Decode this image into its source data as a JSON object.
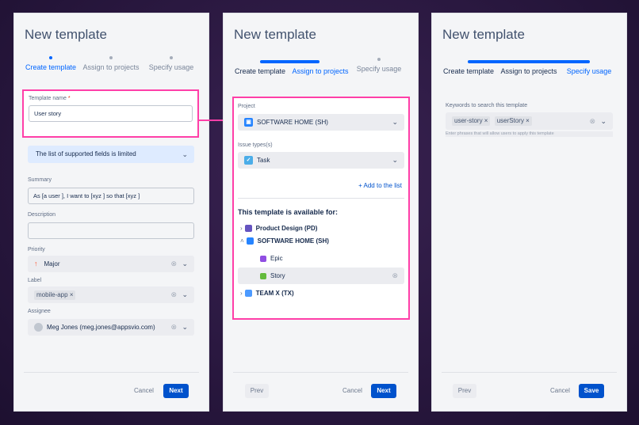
{
  "panels": [
    {
      "title": "New template",
      "steps": [
        "Create template",
        "Assign to projects",
        "Specify usage"
      ],
      "template_name_label": "Template name",
      "required_mark": "*",
      "template_name_value": "User story",
      "info_banner": "The list of supported fields is limited",
      "summary_label": "Summary",
      "summary_value": "As [a user ], I want to [xyz ] so that [xyz ]",
      "description_label": "Description",
      "priority_label": "Priority",
      "priority_value": "Major",
      "label_label": "Label",
      "label_tag": "mobile-app",
      "assignee_label": "Assignee",
      "assignee_value": "Meg Jones (meg.jones@appsvio.com)",
      "cancel": "Cancel",
      "next": "Next"
    },
    {
      "title": "New template",
      "steps": [
        "Create template",
        "Assign to projects",
        "Specify usage"
      ],
      "project_label": "Project",
      "project_value": "SOFTWARE HOME (SH)",
      "issue_types_label": "Issue types(s)",
      "issue_type_value": "Task",
      "add_to_list": "+ Add to the list",
      "available_heading": "This template is available for:",
      "tree": [
        {
          "label": "Product Design (PD)"
        },
        {
          "label": "SOFTWARE HOME (SH)"
        },
        {
          "label": "Epic"
        },
        {
          "label": "Story"
        },
        {
          "label": "TEAM X (TX)"
        }
      ],
      "prev": "Prev",
      "cancel": "Cancel",
      "next": "Next"
    },
    {
      "title": "New template",
      "steps": [
        "Create template",
        "Assign to projects",
        "Specify usage"
      ],
      "keywords_label": "Keywords to search this template",
      "keywords": [
        "user-story",
        "userStory"
      ],
      "keywords_hint": "Enter phrases that will allow users to apply this template",
      "prev": "Prev",
      "cancel": "Cancel",
      "save": "Save"
    }
  ],
  "icons": {
    "chevron": "chevron-down-icon",
    "clear": "clear-icon",
    "remove_tag": "remove-tag-icon"
  },
  "colors": {
    "accent": "#0052cc",
    "highlight": "#ff3fa8",
    "info_banner": "#deebff"
  }
}
